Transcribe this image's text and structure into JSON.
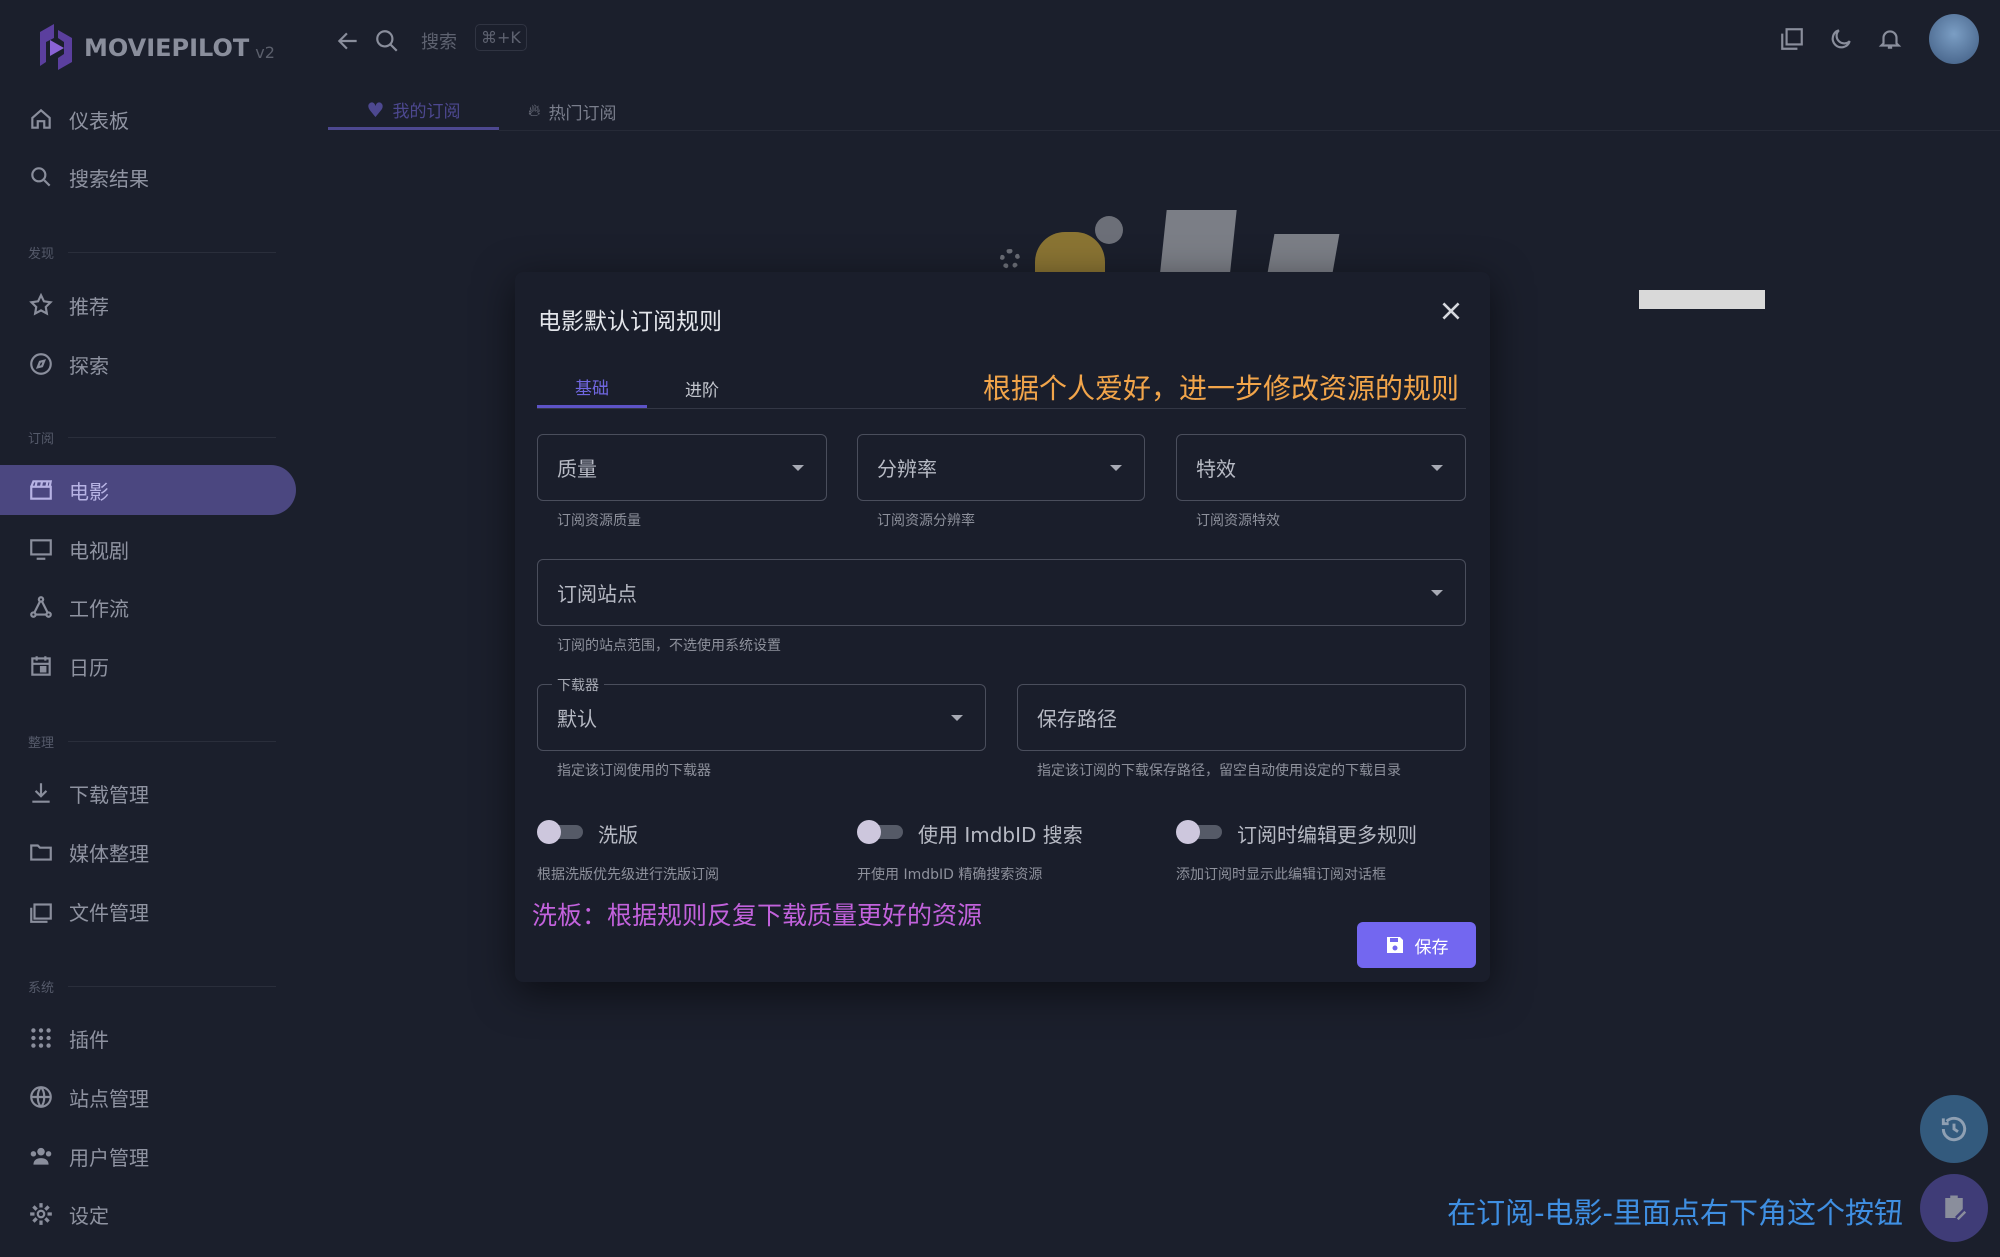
{
  "app": {
    "logo": "MOVIEPILOT",
    "version": "v2"
  },
  "topbar": {
    "search_placeholder": "搜索",
    "shortcut": "⌘+K"
  },
  "sidebar": {
    "items": [
      {
        "label": "仪表板",
        "icon": "home-icon"
      },
      {
        "label": "搜索结果",
        "icon": "search-icon"
      },
      {
        "section": "发现"
      },
      {
        "label": "推荐",
        "icon": "star-icon"
      },
      {
        "label": "探索",
        "icon": "compass-icon"
      },
      {
        "section": "订阅"
      },
      {
        "label": "电影",
        "icon": "movie-icon",
        "active": true
      },
      {
        "label": "电视剧",
        "icon": "tv-icon"
      },
      {
        "label": "工作流",
        "icon": "workflow-icon"
      },
      {
        "label": "日历",
        "icon": "calendar-icon"
      },
      {
        "section": "整理"
      },
      {
        "label": "下载管理",
        "icon": "download-icon"
      },
      {
        "label": "媒体整理",
        "icon": "folder-icon"
      },
      {
        "label": "文件管理",
        "icon": "files-icon"
      },
      {
        "section": "系统"
      },
      {
        "label": "插件",
        "icon": "grid-icon"
      },
      {
        "label": "站点管理",
        "icon": "globe-icon"
      },
      {
        "label": "用户管理",
        "icon": "users-icon"
      },
      {
        "label": "设定",
        "icon": "gear-icon"
      }
    ]
  },
  "tabs": [
    {
      "label": "我的订阅",
      "icon": "heart-icon",
      "active": true
    },
    {
      "label": "热门订阅",
      "icon": "fire-icon"
    }
  ],
  "modal": {
    "title": "电影默认订阅规则",
    "tabs": [
      {
        "label": "基础",
        "active": true
      },
      {
        "label": "进阶"
      }
    ],
    "fields": {
      "quality": {
        "label": "质量",
        "hint": "订阅资源质量"
      },
      "resolution": {
        "label": "分辨率",
        "hint": "订阅资源分辨率"
      },
      "effect": {
        "label": "特效",
        "hint": "订阅资源特效"
      },
      "sites": {
        "label": "订阅站点",
        "hint": "订阅的站点范围，不选使用系统设置"
      },
      "downloader": {
        "label": "下载器",
        "value": "默认",
        "hint": "指定该订阅使用的下载器"
      },
      "save_path": {
        "placeholder": "保存路径",
        "hint": "指定该订阅的下载保存路径，留空自动使用设定的下载目录"
      }
    },
    "toggles": [
      {
        "label": "洗版",
        "hint": "根据洗版优先级进行洗版订阅",
        "on": false
      },
      {
        "label": "使用 ImdbID 搜索",
        "hint": "开使用 ImdbID 精确搜索资源",
        "on": false
      },
      {
        "label": "订阅时编辑更多规则",
        "hint": "添加订阅时显示此编辑订阅对话框",
        "on": false
      }
    ],
    "save_label": "保存"
  },
  "annotations": {
    "rules": "根据个人爱好，进一步修改资源的规则",
    "wash": "洗板：根据规则反复下载质量更好的资源",
    "button": "在订阅-电影-里面点右下角这个按钮"
  },
  "colors": {
    "accent": "#7367f0",
    "orange": "#f2a54a",
    "purple": "#c262dc",
    "blue": "#3f8fe2"
  }
}
